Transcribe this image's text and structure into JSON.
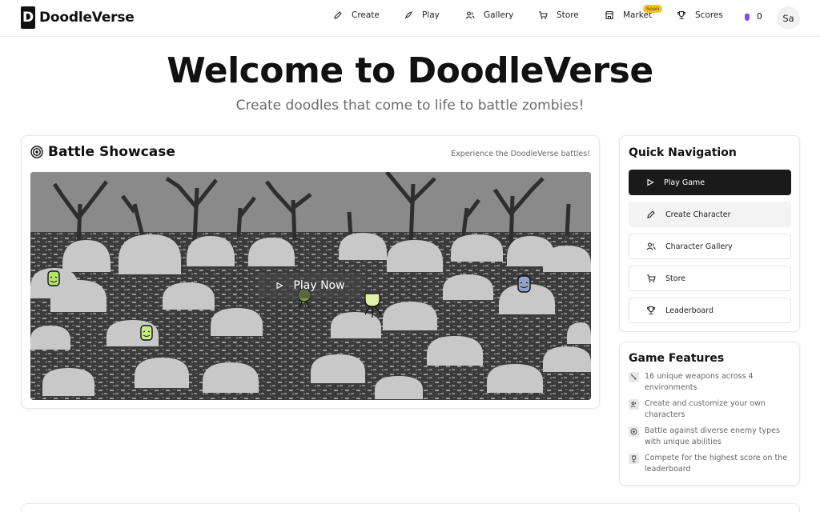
{
  "header": {
    "logo_letter": "D",
    "app_name": "DoodleVerse",
    "nav": [
      {
        "label": "Create",
        "icon": "pencil-icon"
      },
      {
        "label": "Play",
        "icon": "rocket-icon"
      },
      {
        "label": "Gallery",
        "icon": "users-icon"
      },
      {
        "label": "Store",
        "icon": "cart-icon"
      },
      {
        "label": "Market",
        "icon": "store-icon",
        "badge": "Soon"
      },
      {
        "label": "Scores",
        "icon": "trophy-icon"
      }
    ],
    "coins": "0",
    "avatar_initials": "Sa"
  },
  "hero": {
    "title": "Welcome to DoodleVerse",
    "subtitle": "Create doodles that come to life to battle zombies!"
  },
  "showcase": {
    "title": "Battle Showcase",
    "note": "Experience the DoodleVerse battles!",
    "play_label": "Play Now"
  },
  "quick_nav": {
    "title": "Quick Navigation",
    "buttons": [
      {
        "label": "Play Game",
        "icon": "play-icon"
      },
      {
        "label": "Create Character",
        "icon": "pencil-icon"
      },
      {
        "label": "Character Gallery",
        "icon": "users-icon"
      },
      {
        "label": "Store",
        "icon": "cart-icon"
      },
      {
        "label": "Leaderboard",
        "icon": "trophy-icon"
      }
    ]
  },
  "features": {
    "title": "Game Features",
    "items": [
      {
        "line1": "16 unique weapons across 4",
        "line2": "environments",
        "icon": "sword-icon"
      },
      {
        "line1": "Create and customize your own",
        "line2": "characters",
        "icon": "users-icon"
      },
      {
        "line1": "Battle against diverse enemy types",
        "line2": "with unique abilities",
        "icon": "target-icon"
      },
      {
        "line1": "Compete for the highest score on the",
        "line2": "leaderboard",
        "icon": "trophy-icon"
      }
    ]
  },
  "colors": {
    "accent_dark": "#1a1a1a",
    "badge": "#f6c31a",
    "gem": "#8a4de0"
  }
}
